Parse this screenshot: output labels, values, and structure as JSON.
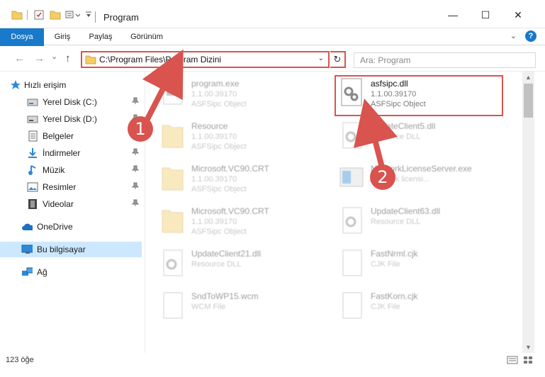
{
  "window": {
    "title": "Program",
    "minimize_glyph": "—",
    "maximize_glyph": "☐",
    "close_glyph": "✕"
  },
  "ribbon": {
    "tabs": [
      {
        "label": "Dosya"
      },
      {
        "label": "Giriş"
      },
      {
        "label": "Paylaş"
      },
      {
        "label": "Görünüm"
      }
    ],
    "expand_glyph": "⌄",
    "help_glyph": "?"
  },
  "nav": {
    "back_glyph": "←",
    "forward_glyph": "→",
    "recent_glyph": "⌄",
    "up_glyph": "↑",
    "address_path": "C:\\Program Files\\Program Dizini",
    "address_dropdown_glyph": "⌄",
    "refresh_glyph": "↻",
    "search_placeholder": "Ara: Program"
  },
  "sidebar": {
    "items": [
      {
        "label": "Hızlı erişim",
        "icon": "star-icon",
        "pinned": false
      },
      {
        "label": "Yerel Disk (C:)",
        "icon": "drive-icon",
        "pinned": true
      },
      {
        "label": "Yerel Disk (D:)",
        "icon": "drive-icon",
        "pinned": true
      },
      {
        "label": "Belgeler",
        "icon": "documents-icon",
        "pinned": true
      },
      {
        "label": "İndirmeler",
        "icon": "download-icon",
        "pinned": true
      },
      {
        "label": "Müzik",
        "icon": "music-icon",
        "pinned": true
      },
      {
        "label": "Resimler",
        "icon": "pictures-icon",
        "pinned": true
      },
      {
        "label": "Videolar",
        "icon": "video-icon",
        "pinned": true
      },
      {
        "label": "OneDrive",
        "icon": "cloud-icon",
        "pinned": false
      },
      {
        "label": "Bu bilgisayar",
        "icon": "computer-icon",
        "pinned": false,
        "selected": true
      },
      {
        "label": "Ağ",
        "icon": "network-icon",
        "pinned": false
      }
    ],
    "pin_glyph": "📌"
  },
  "files": {
    "left_column": [
      {
        "name": "program.exe",
        "meta1": "1.1.00.39170",
        "meta2": "ASFSipc Object",
        "kind": "exe"
      },
      {
        "name": "Resource",
        "meta1": "1.1.00.39170",
        "meta2": "ASFSipc Object",
        "kind": "folder"
      },
      {
        "name": "Microsoft.VC90.CRT",
        "meta1": "1.1.00.39170",
        "meta2": "ASFSipc Object",
        "kind": "folder"
      },
      {
        "name": "Microsoft.VC90.CRT",
        "meta1": "1.1.00.39170",
        "meta2": "ASFSipc Object",
        "kind": "folder"
      },
      {
        "name": "UpdateClient21.dll",
        "meta1": "Resource DLL",
        "meta2": "",
        "kind": "dll"
      },
      {
        "name": "SndToWP15.wcm",
        "meta1": "WCM File",
        "meta2": "",
        "kind": "doc"
      }
    ],
    "right_column": [
      {
        "name": "asfsipc.dll",
        "meta1": "1.1.00.39170",
        "meta2": "ASFSipc Object",
        "kind": "dll",
        "highlighted": true
      },
      {
        "name": "UpdateClient5.dll",
        "meta1": "Resource DLL",
        "meta2": "",
        "kind": "dll"
      },
      {
        "name": "NetworkLicenseServer.exe",
        "meta1": "Network licensi...",
        "meta2": "",
        "kind": "app"
      },
      {
        "name": "UpdateClient63.dll",
        "meta1": "Resource DLL",
        "meta2": "",
        "kind": "dll"
      },
      {
        "name": "FastNrml.cjk",
        "meta1": "CJK File",
        "meta2": "",
        "kind": "doc"
      },
      {
        "name": "FastKorn.cjk",
        "meta1": "CJK File",
        "meta2": "",
        "kind": "doc"
      }
    ]
  },
  "status": {
    "item_count": "123 öğe"
  },
  "annotations": {
    "badge_1": "1",
    "badge_2": "2",
    "accent_color": "#d9534f"
  },
  "colors": {
    "file_tab_bg": "#1979ca",
    "selected_bg": "#cce8ff"
  }
}
